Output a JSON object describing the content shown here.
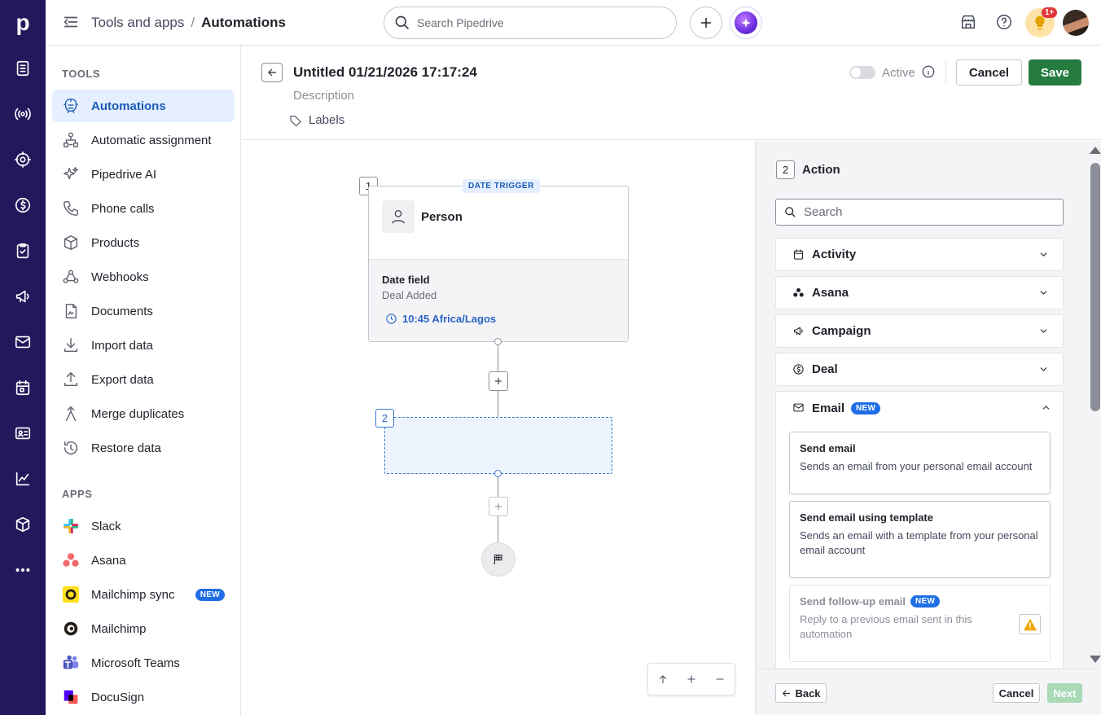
{
  "topbar": {
    "breadcrumb_parent": "Tools and apps",
    "breadcrumb_separator": "/",
    "breadcrumb_current": "Automations",
    "search_placeholder": "Search Pipedrive",
    "notification_badge": "1+"
  },
  "rail": {
    "logo": "p",
    "icons": [
      "deals-list-icon",
      "leads-broadcast-icon",
      "target-icon",
      "dollar-icon",
      "tasks-icon",
      "campaigns-icon",
      "mail-icon",
      "calendar-icon",
      "contacts-card-icon",
      "insights-chart-icon",
      "products-box-icon",
      "more-icon"
    ]
  },
  "sidebar": {
    "tools_heading": "TOOLS",
    "tools": [
      {
        "label": "Automations",
        "icon": "automations-icon",
        "active": true
      },
      {
        "label": "Automatic assignment",
        "icon": "assignment-icon"
      },
      {
        "label": "Pipedrive AI",
        "icon": "sparkle-icon"
      },
      {
        "label": "Phone calls",
        "icon": "phone-icon"
      },
      {
        "label": "Products",
        "icon": "box-icon"
      },
      {
        "label": "Webhooks",
        "icon": "webhook-icon"
      },
      {
        "label": "Documents",
        "icon": "document-icon"
      },
      {
        "label": "Import data",
        "icon": "download-icon"
      },
      {
        "label": "Export data",
        "icon": "upload-icon"
      },
      {
        "label": "Merge duplicates",
        "icon": "merge-icon"
      },
      {
        "label": "Restore data",
        "icon": "restore-icon"
      }
    ],
    "apps_heading": "APPS",
    "apps": [
      {
        "label": "Slack",
        "icon": "slack-icon"
      },
      {
        "label": "Asana",
        "icon": "asana-icon"
      },
      {
        "label": "Mailchimp sync",
        "icon": "mailchimp-sync-icon",
        "badge": "NEW"
      },
      {
        "label": "Mailchimp",
        "icon": "mailchimp-icon"
      },
      {
        "label": "Microsoft Teams",
        "icon": "teams-icon"
      },
      {
        "label": "DocuSign",
        "icon": "docusign-icon"
      }
    ]
  },
  "header": {
    "title": "Untitled 01/21/2026 17:17:24",
    "description_placeholder": "Description",
    "labels": "Labels",
    "active_label": "Active",
    "cancel": "Cancel",
    "save": "Save"
  },
  "canvas": {
    "step1_number": "1",
    "trigger_badge": "DATE TRIGGER",
    "trigger_object": "Person",
    "date_field_label": "Date field",
    "date_field_value": "Deal Added",
    "time": "10:45 Africa/Lagos",
    "step2_number": "2"
  },
  "panel": {
    "step_number": "2",
    "title": "Action",
    "search_placeholder": "Search",
    "categories": [
      {
        "label": "Activity",
        "icon": "calendar-icon"
      },
      {
        "label": "Asana",
        "icon": "asana-icon"
      },
      {
        "label": "Campaign",
        "icon": "megaphone-icon"
      },
      {
        "label": "Deal",
        "icon": "dollar-icon"
      }
    ],
    "email": {
      "label": "Email",
      "badge": "NEW",
      "options": [
        {
          "title": "Send email",
          "desc": "Sends an email from your personal email account"
        },
        {
          "title": "Send email using template",
          "desc": "Sends an email with a template from your personal email account"
        },
        {
          "title": "Send follow-up email",
          "badge": "NEW",
          "desc": "Reply to a previous email sent in this automation",
          "disabled": true
        }
      ]
    },
    "footer": {
      "back": "Back",
      "cancel": "Cancel",
      "next": "Next"
    }
  },
  "colors": {
    "rail": "#22195c",
    "accent_blue": "#1b5cb6",
    "save_green": "#267b3f",
    "next_disabled": "#a9d9b6",
    "new_badge": "#1f6ee5"
  }
}
